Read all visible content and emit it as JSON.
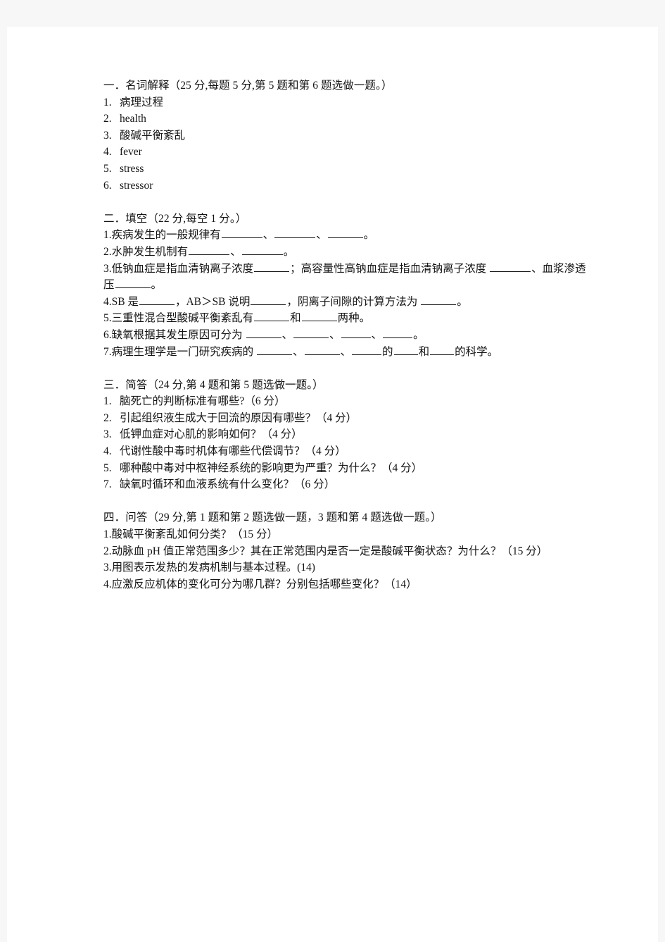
{
  "document": {
    "type": "exam-paper",
    "language": "zh-CN",
    "text_color": "#141414",
    "page_background": "#ffffff",
    "canvas_background": "#f7f7f7"
  },
  "sections": [
    {
      "id": "section-1",
      "heading": "一．名词解释（25 分,每题 5 分,第 5 题和第 6 题选做一题。）",
      "number_style": "wide",
      "items": [
        {
          "num": "1.",
          "text": "病理过程"
        },
        {
          "num": "2.",
          "text": "health"
        },
        {
          "num": "3.",
          "text": "酸碱平衡紊乱"
        },
        {
          "num": "4.",
          "text": "fever"
        },
        {
          "num": "5.",
          "text": "stress"
        },
        {
          "num": "6.",
          "text": "stressor"
        }
      ]
    },
    {
      "id": "section-2",
      "heading": "二．填空（22 分,每空 1 分。）",
      "number_style": "tight",
      "items": [
        {
          "num": "1.",
          "parts": [
            "疾病发生的一般规律有",
            "_b-lg_",
            "、",
            "_b-lg_",
            "、",
            "_b-md_",
            "。"
          ]
        },
        {
          "num": "2.",
          "parts": [
            "水肿发生机制有",
            "_b-lg_",
            "、",
            "_b-lg_",
            "。"
          ]
        },
        {
          "num": "3.",
          "parts": [
            "低钠血症是指血清钠离子浓度",
            "_b-md_",
            "；高容量性高钠血症是指血清钠离子浓度 ",
            "_b-lg_",
            "、血浆渗透压",
            "_b-md_",
            "。"
          ]
        },
        {
          "num": "4.",
          "parts": [
            "SB 是",
            "_b-md_",
            "，AB＞SB 说明",
            "_b-md_",
            "，阴离子间隙的计算方法为 ",
            "_b-md_",
            "。"
          ]
        },
        {
          "num": "5.",
          "parts": [
            "三重性混合型酸碱平衡紊乱有",
            "_b-md_",
            "和",
            "_b-md_",
            "两种。"
          ]
        },
        {
          "num": "6.",
          "parts": [
            "缺氧根据其发生原因可分为 ",
            "_b-md_",
            "、",
            "_b-md_",
            "、",
            "_b-sm_",
            "、",
            "_b-sm_",
            "。"
          ]
        },
        {
          "num": "7.",
          "parts": [
            "病理生理学是一门研究疾病的 ",
            "_b-md_",
            "、",
            "_b-md_",
            "、",
            "_b-sm_",
            "的",
            "_b-xs_",
            "和",
            "_b-xs_",
            "的科学。"
          ]
        }
      ]
    },
    {
      "id": "section-3",
      "heading": "三．简答（24 分,第 4 题和第 5 题选做一题。）",
      "number_style": "wide",
      "items": [
        {
          "num": "1.",
          "text": "脑死亡的判断标准有哪些?（6 分）"
        },
        {
          "num": "2.",
          "text": "引起组织液生成大于回流的原因有哪些？（4 分）"
        },
        {
          "num": "3.",
          "text": "低钾血症对心肌的影响如何？（4 分）"
        },
        {
          "num": "4.",
          "text": "代谢性酸中毒时机体有哪些代偿调节？（4 分）"
        },
        {
          "num": "5.",
          "text": "哪种酸中毒对中枢神经系统的影响更为严重？为什么？（4 分）"
        },
        {
          "num": "7.",
          "text": "缺氧时循环和血液系统有什么变化？（6 分）"
        }
      ]
    },
    {
      "id": "section-4",
      "heading": "四．问答（29 分,第 1 题和第 2 题选做一题，3 题和第 4 题选做一题。）",
      "number_style": "tight",
      "items": [
        {
          "num": "1.",
          "text": "酸碱平衡紊乱如何分类？（15 分）"
        },
        {
          "num": "2.",
          "text": "动脉血 pH 值正常范围多少？其在正常范围内是否一定是酸碱平衡状态？为什么？（15 分）"
        },
        {
          "num": "3.",
          "text": "用图表示发热的发病机制与基本过程。(14)"
        },
        {
          "num": "4.",
          "text": "应激反应机体的变化可分为哪几群？分别包括哪些变化？（14）"
        }
      ]
    }
  ]
}
